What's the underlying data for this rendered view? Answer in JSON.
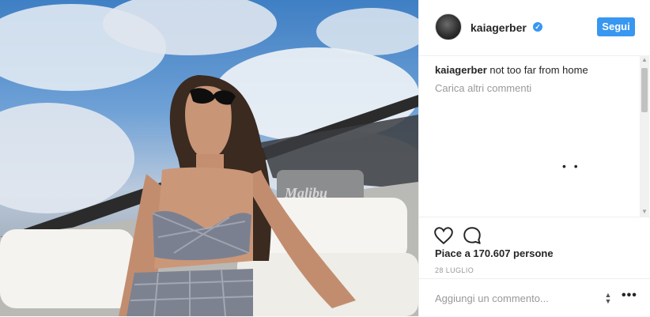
{
  "post": {
    "image_alt": "Woman in sunglasses and gingham top seated in a Malibu boat",
    "boat_brand": "Malibu"
  },
  "header": {
    "username": "kaiagerber",
    "verified_icon": "verified-badge-icon",
    "follow_label": "Segui"
  },
  "comments": {
    "caption_user": "kaiagerber",
    "caption_text": "not too far from home",
    "load_more": "Carica altri commenti",
    "loading": "• •"
  },
  "actions": {
    "like_icon": "heart-icon",
    "comment_icon": "comment-bubble-icon",
    "likes_text": "Piace a 170.607 persone",
    "date": "28 LUGLIO"
  },
  "add_comment": {
    "placeholder": "Aggiungi un commento...",
    "more_icon": "ellipsis-icon"
  },
  "colors": {
    "accent": "#3897f0",
    "text": "#262626",
    "muted": "#999999"
  }
}
